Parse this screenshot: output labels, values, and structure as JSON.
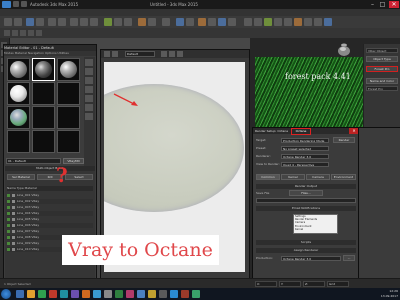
{
  "window": {
    "app_title": "Autodesk 3ds Max 2015",
    "doc_title": "Untitled - 3ds Max 2015",
    "minimize": "–",
    "maximize": "□",
    "close": "✕"
  },
  "material_editor": {
    "title": "Material Editor - 01 - Default",
    "menu": "Modes Material Navigation Options Utilities",
    "slots": [
      "gray-sphere",
      "dark-sphere",
      "gray-sphere",
      "gray-sphere",
      "green-sphere",
      "empty",
      "empty",
      "empty",
      "white-sphere",
      "empty",
      "empty",
      "empty"
    ],
    "material_name": "01 - Default",
    "material_type": "VRayMtl"
  },
  "multi_filter": {
    "title": "Multi-Object Batch",
    "buttons": [
      "Sel Material",
      "Rdl",
      "Select"
    ],
    "header": "Name  Type  Material",
    "rows": [
      "Line_001  VRay",
      "Line_002  VRay",
      "Line_003  VRay",
      "Line_004  VRay",
      "Line_005  VRay",
      "Line_006  VRay",
      "Line_007  VRay",
      "Line_008  VRay",
      "Line_009  VRay",
      "Line_010  VRay"
    ]
  },
  "render_frame": {
    "select_value": "Default"
  },
  "forest_pack": {
    "label": "forest pack 4.41"
  },
  "command_panel": {
    "fields": [
      "VRay Object",
      "Forest Pro"
    ],
    "buttons": [
      "Object Type",
      "Forest Pro",
      "Name and Color"
    ]
  },
  "render_setup": {
    "title": "Render Setup: Octane",
    "badge": "Octane",
    "rows": [
      {
        "label": "Target:",
        "value": "Production Rendering Mode"
      },
      {
        "label": "Preset:",
        "value": "No preset selected"
      },
      {
        "label": "Renderer:",
        "value": "Octane Render 3.0"
      },
      {
        "label": "View to Render:",
        "value": "Quad 4 - Perspective"
      }
    ],
    "render_btn": "Render",
    "tabs": [
      "Common",
      "Kernel",
      "Camera",
      "Environment"
    ],
    "sections": [
      "Render Output",
      "Email Notifications",
      "Scripts"
    ],
    "file_label": "Save File",
    "files_btn": "Files...",
    "list_items": [
      "Settings",
      "Render Elements",
      "Camera",
      "Environment",
      "Kernel"
    ],
    "assign_section": "Assign Renderer",
    "production_label": "Production:",
    "production_value": "Octane Render 3.0"
  },
  "caption": {
    "text": "Vray to Octane"
  },
  "status": {
    "text": "1 Object Selected",
    "coords": [
      "X:",
      "Y:",
      "Z:",
      "Grid"
    ]
  },
  "taskbar": {
    "time": "12:26",
    "date": "13.09.2017"
  },
  "colors": {
    "caption_text": "#e0474a",
    "annotation_red": "#e03030",
    "forest_green": "#1c4b1c"
  }
}
